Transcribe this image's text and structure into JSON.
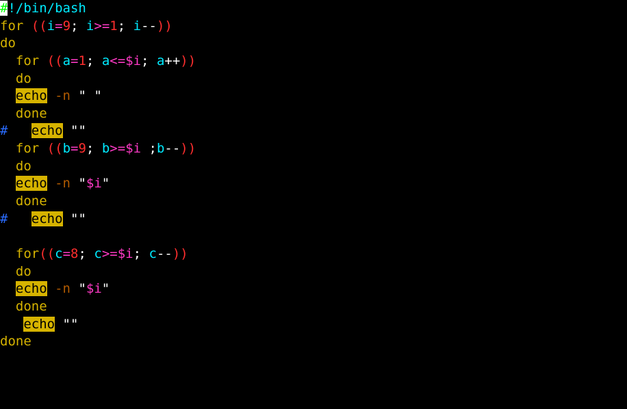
{
  "lines": [
    {
      "id": "l0",
      "tokens": [
        {
          "t": "#",
          "cls": "cursor-green"
        },
        {
          "t": "!/bin/bash",
          "cls": "c-cyan"
        }
      ]
    },
    {
      "id": "l1",
      "tokens": [
        {
          "t": "for",
          "cls": "c-yellow"
        },
        {
          "t": " ",
          "cls": "c-white"
        },
        {
          "t": "((",
          "cls": "c-red"
        },
        {
          "t": "i",
          "cls": "c-cyan"
        },
        {
          "t": "=",
          "cls": "c-magenta"
        },
        {
          "t": "9",
          "cls": "c-red"
        },
        {
          "t": "; ",
          "cls": "c-white"
        },
        {
          "t": "i",
          "cls": "c-cyan"
        },
        {
          "t": ">=",
          "cls": "c-magenta"
        },
        {
          "t": "1",
          "cls": "c-red"
        },
        {
          "t": "; ",
          "cls": "c-white"
        },
        {
          "t": "i",
          "cls": "c-cyan"
        },
        {
          "t": "--",
          "cls": "c-white"
        },
        {
          "t": "))",
          "cls": "c-red"
        }
      ]
    },
    {
      "id": "l2",
      "tokens": [
        {
          "t": "do",
          "cls": "c-yellow"
        }
      ]
    },
    {
      "id": "l3",
      "tokens": [
        {
          "t": "  ",
          "cls": "c-white"
        },
        {
          "t": "for",
          "cls": "c-yellow"
        },
        {
          "t": " ",
          "cls": "c-white"
        },
        {
          "t": "((",
          "cls": "c-red"
        },
        {
          "t": "a",
          "cls": "c-cyan"
        },
        {
          "t": "=",
          "cls": "c-magenta"
        },
        {
          "t": "1",
          "cls": "c-red"
        },
        {
          "t": "; ",
          "cls": "c-white"
        },
        {
          "t": "a",
          "cls": "c-cyan"
        },
        {
          "t": "<=",
          "cls": "c-magenta"
        },
        {
          "t": "$i",
          "cls": "c-magenta"
        },
        {
          "t": "; ",
          "cls": "c-white"
        },
        {
          "t": "a",
          "cls": "c-cyan"
        },
        {
          "t": "++",
          "cls": "c-white"
        },
        {
          "t": "))",
          "cls": "c-red"
        }
      ]
    },
    {
      "id": "l4",
      "tokens": [
        {
          "t": "  ",
          "cls": "c-white"
        },
        {
          "t": "do",
          "cls": "c-yellow"
        }
      ]
    },
    {
      "id": "l5",
      "tokens": [
        {
          "t": "  ",
          "cls": "c-white"
        },
        {
          "t": "echo",
          "cls": "c-yellowbg"
        },
        {
          "t": " ",
          "cls": "c-white"
        },
        {
          "t": "-n",
          "cls": "c-brown"
        },
        {
          "t": " ",
          "cls": "c-white"
        },
        {
          "t": "\" \"",
          "cls": "c-white"
        }
      ]
    },
    {
      "id": "l6",
      "tokens": [
        {
          "t": "  ",
          "cls": "c-white"
        },
        {
          "t": "done",
          "cls": "c-yellow"
        }
      ]
    },
    {
      "id": "l7",
      "tokens": [
        {
          "t": "#",
          "cls": "c-blue"
        },
        {
          "t": "   ",
          "cls": "c-white"
        },
        {
          "t": "echo",
          "cls": "c-yellowbg"
        },
        {
          "t": " ",
          "cls": "c-white"
        },
        {
          "t": "\"\"",
          "cls": "c-white"
        }
      ]
    },
    {
      "id": "l8",
      "tokens": [
        {
          "t": "  ",
          "cls": "c-white"
        },
        {
          "t": "for",
          "cls": "c-yellow"
        },
        {
          "t": " ",
          "cls": "c-white"
        },
        {
          "t": "((",
          "cls": "c-red"
        },
        {
          "t": "b",
          "cls": "c-cyan"
        },
        {
          "t": "=",
          "cls": "c-magenta"
        },
        {
          "t": "9",
          "cls": "c-red"
        },
        {
          "t": "; ",
          "cls": "c-white"
        },
        {
          "t": "b",
          "cls": "c-cyan"
        },
        {
          "t": ">=",
          "cls": "c-magenta"
        },
        {
          "t": "$i",
          "cls": "c-magenta"
        },
        {
          "t": " ;",
          "cls": "c-white"
        },
        {
          "t": "b",
          "cls": "c-cyan"
        },
        {
          "t": "--",
          "cls": "c-white"
        },
        {
          "t": "))",
          "cls": "c-red"
        }
      ]
    },
    {
      "id": "l9",
      "tokens": [
        {
          "t": "  ",
          "cls": "c-white"
        },
        {
          "t": "do",
          "cls": "c-yellow"
        }
      ]
    },
    {
      "id": "l10",
      "tokens": [
        {
          "t": "  ",
          "cls": "c-white"
        },
        {
          "t": "echo",
          "cls": "c-yellowbg"
        },
        {
          "t": " ",
          "cls": "c-white"
        },
        {
          "t": "-n",
          "cls": "c-brown"
        },
        {
          "t": " ",
          "cls": "c-white"
        },
        {
          "t": "\"",
          "cls": "c-white"
        },
        {
          "t": "$i",
          "cls": "c-magenta"
        },
        {
          "t": "\"",
          "cls": "c-white"
        }
      ]
    },
    {
      "id": "l11",
      "tokens": [
        {
          "t": "  ",
          "cls": "c-white"
        },
        {
          "t": "done",
          "cls": "c-yellow"
        }
      ]
    },
    {
      "id": "l12",
      "tokens": [
        {
          "t": "#",
          "cls": "c-blue"
        },
        {
          "t": "   ",
          "cls": "c-white"
        },
        {
          "t": "echo",
          "cls": "c-yellowbg"
        },
        {
          "t": " ",
          "cls": "c-white"
        },
        {
          "t": "\"\"",
          "cls": "c-white"
        }
      ]
    },
    {
      "id": "l13",
      "tokens": [
        {
          "t": " ",
          "cls": "c-white"
        }
      ]
    },
    {
      "id": "l14",
      "tokens": [
        {
          "t": "  ",
          "cls": "c-white"
        },
        {
          "t": "for",
          "cls": "c-yellow"
        },
        {
          "t": "((",
          "cls": "c-red"
        },
        {
          "t": "c",
          "cls": "c-cyan"
        },
        {
          "t": "=",
          "cls": "c-magenta"
        },
        {
          "t": "8",
          "cls": "c-red"
        },
        {
          "t": "; ",
          "cls": "c-white"
        },
        {
          "t": "c",
          "cls": "c-cyan"
        },
        {
          "t": ">=",
          "cls": "c-magenta"
        },
        {
          "t": "$i",
          "cls": "c-magenta"
        },
        {
          "t": "; ",
          "cls": "c-white"
        },
        {
          "t": "c",
          "cls": "c-cyan"
        },
        {
          "t": "--",
          "cls": "c-white"
        },
        {
          "t": "))",
          "cls": "c-red"
        }
      ]
    },
    {
      "id": "l15",
      "tokens": [
        {
          "t": "  ",
          "cls": "c-white"
        },
        {
          "t": "do",
          "cls": "c-yellow"
        }
      ]
    },
    {
      "id": "l16",
      "tokens": [
        {
          "t": "  ",
          "cls": "c-white"
        },
        {
          "t": "echo",
          "cls": "c-yellowbg"
        },
        {
          "t": " ",
          "cls": "c-white"
        },
        {
          "t": "-n",
          "cls": "c-brown"
        },
        {
          "t": " ",
          "cls": "c-white"
        },
        {
          "t": "\"",
          "cls": "c-white"
        },
        {
          "t": "$i",
          "cls": "c-magenta"
        },
        {
          "t": "\"",
          "cls": "c-white"
        }
      ]
    },
    {
      "id": "l17",
      "tokens": [
        {
          "t": "  ",
          "cls": "c-white"
        },
        {
          "t": "done",
          "cls": "c-yellow"
        }
      ]
    },
    {
      "id": "l18",
      "tokens": [
        {
          "t": "   ",
          "cls": "c-white"
        },
        {
          "t": "echo",
          "cls": "c-yellowbg"
        },
        {
          "t": " ",
          "cls": "c-white"
        },
        {
          "t": "\"\"",
          "cls": "c-white"
        }
      ]
    },
    {
      "id": "l19",
      "tokens": [
        {
          "t": "done",
          "cls": "c-yellow"
        }
      ]
    }
  ]
}
